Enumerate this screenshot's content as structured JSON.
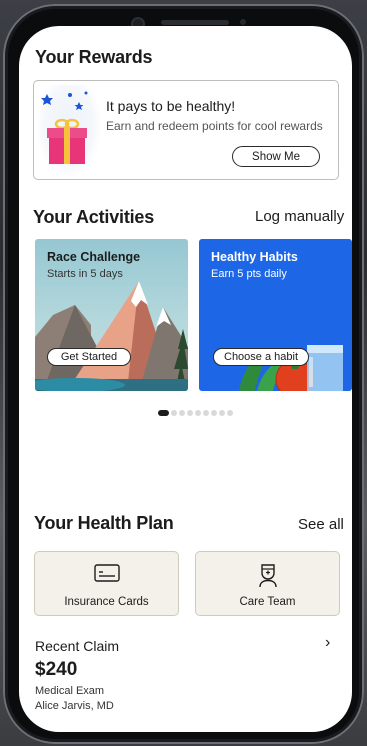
{
  "rewards": {
    "title": "Your Rewards",
    "card_title": "It pays to be healthy!",
    "card_subtitle": "Earn and redeem points for cool rewards",
    "button": "Show Me"
  },
  "activities": {
    "title": "Your Activities",
    "link": "Log manually",
    "cards": [
      {
        "title": "Race Challenge",
        "subtitle": "Starts in 5 days",
        "button": "Get Started"
      },
      {
        "title": "Healthy Habits",
        "subtitle": "Earn 5 pts daily",
        "button": "Choose a habit"
      }
    ],
    "pager": {
      "total": 9,
      "active": 1
    }
  },
  "health_plan": {
    "title": "Your Health Plan",
    "link": "See all",
    "tiles": [
      {
        "label": "Insurance Cards",
        "icon": "card-icon"
      },
      {
        "label": "Care Team",
        "icon": "doctor-icon"
      }
    ]
  },
  "claim": {
    "label": "Recent Claim",
    "amount": "$240",
    "type": "Medical Exam",
    "provider": "Alice Jarvis, MD"
  },
  "colors": {
    "habits_blue": "#1d66e6",
    "tile_bg": "#f3f1ea",
    "gift_pink": "#e8357a",
    "gift_ribbon": "#f5c23c",
    "star_blue": "#1b55d6"
  }
}
